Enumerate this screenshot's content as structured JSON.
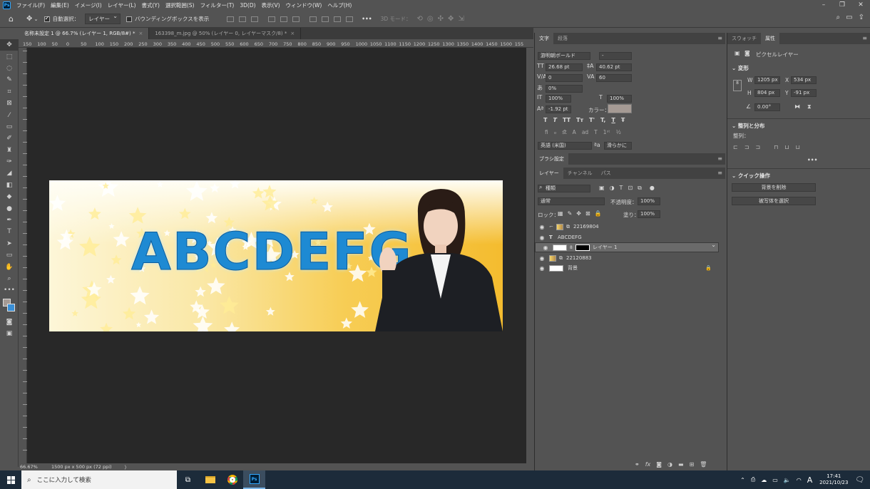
{
  "menubar": {
    "logo": "Ps",
    "items": [
      "ファイル(F)",
      "編集(E)",
      "イメージ(I)",
      "レイヤー(L)",
      "書式(Y)",
      "選択範囲(S)",
      "フィルター(T)",
      "3D(D)",
      "表示(V)",
      "ウィンドウ(W)",
      "ヘルプ(H)"
    ]
  },
  "options": {
    "auto_select": "自動選択：",
    "auto_select_target": "レイヤー",
    "bounding_box": "バウンディングボックスを表示",
    "more": "•••",
    "mode_3d": "3D モード："
  },
  "tabs": [
    {
      "label": "名称未設定 1 @ 66.7% (レイヤー 1, RGB/8#) *",
      "close": "×"
    },
    {
      "label": "163398_m.jpg @ 50% (レイヤー 0, レイヤーマスク/8) *",
      "close": "×"
    }
  ],
  "ruler": {
    "h_ticks": [
      "150",
      "100",
      "50",
      "0",
      "50",
      "100",
      "150",
      "200",
      "250",
      "300",
      "350",
      "400",
      "450",
      "500",
      "550",
      "600",
      "650",
      "700",
      "750",
      "800",
      "850",
      "900",
      "950",
      "1000",
      "1050",
      "1100",
      "1150",
      "1200",
      "1250",
      "1300",
      "1350",
      "1400",
      "1450",
      "1500",
      "155"
    ]
  },
  "canvas": {
    "artwork_text": "ABCDEFG",
    "image_colors": {
      "gold": "#f4bc2f",
      "blue_letters": "#1e8ad3",
      "suit": "#1d1f24"
    }
  },
  "status": {
    "zoom": "66.67%",
    "doc_info": "1500 px x 500 px (72 ppi)",
    "arrow": "〉"
  },
  "character_panel": {
    "tabs": [
      "文字",
      "段落"
    ],
    "font_family": "游明朝ボールド",
    "font_style": "-",
    "size": "26.68 pt",
    "leading": "40.62 pt",
    "kerning": "0",
    "tracking": "60",
    "tsume": "0%",
    "vscale": "100%",
    "hscale": "100%",
    "baseline": "-1.92 pt",
    "color_label": "カラー：",
    "color_swatch": "#a59a94",
    "style_buttons": [
      "T",
      "T",
      "TT",
      "Tт",
      "T'",
      "T,",
      "T",
      "Ŧ"
    ],
    "opentype_buttons": [
      "ﬁ",
      "ℴ",
      "ﬆ",
      "A",
      "ad",
      "T",
      "1ˢᵗ",
      "½"
    ],
    "language": "英語 (米国)",
    "aa_label": "ªa",
    "antialias": "滑らかに"
  },
  "brush_panel": {
    "tab": "ブラシ設定"
  },
  "layers_panel": {
    "tabs": [
      "レイヤー",
      "チャンネル",
      "パス"
    ],
    "filter_kind": "種類",
    "blend_mode": "通常",
    "opacity_label": "不透明度：",
    "opacity": "100%",
    "lock_label": "ロック：",
    "fill_label": "塗り：",
    "fill": "100%",
    "layers": [
      {
        "name": "22169804",
        "type": "smart",
        "selected": false,
        "locked": false
      },
      {
        "name": "ABCDEFG",
        "type": "text",
        "selected": false,
        "locked": false
      },
      {
        "name": "レイヤー 1",
        "type": "masked",
        "selected": true,
        "locked": false
      },
      {
        "name": "22120883",
        "type": "smart",
        "selected": false,
        "locked": false
      },
      {
        "name": "背景",
        "type": "background",
        "selected": false,
        "locked": true
      }
    ],
    "lock_icon": "🔒",
    "bottom_icons": [
      "link-icon",
      "fx-icon",
      "mask-icon",
      "adjustment-icon",
      "folder-icon",
      "new-layer-icon",
      "trash-icon"
    ],
    "fx_label": "fx"
  },
  "properties_panel": {
    "tabs": [
      "スウォッチ",
      "属性"
    ],
    "layer_kind": "ピクセルレイヤー",
    "transform_title": "変形",
    "w_label": "W",
    "w": "1205 px",
    "x_label": "X",
    "x": "534 px",
    "h_label": "H",
    "h": "804 px",
    "y_label": "Y",
    "y": "-91 px",
    "angle": "0.00°",
    "align_title": "整列と分布",
    "align_label": "整列：",
    "more": "•••",
    "quick_title": "クイック操作",
    "quick_buttons": [
      "背景を削除",
      "被写体を選択"
    ]
  },
  "taskbar": {
    "search_placeholder": "ここに入力して検索",
    "time": "17:41",
    "date": "2021/10/23",
    "ime": "A"
  }
}
